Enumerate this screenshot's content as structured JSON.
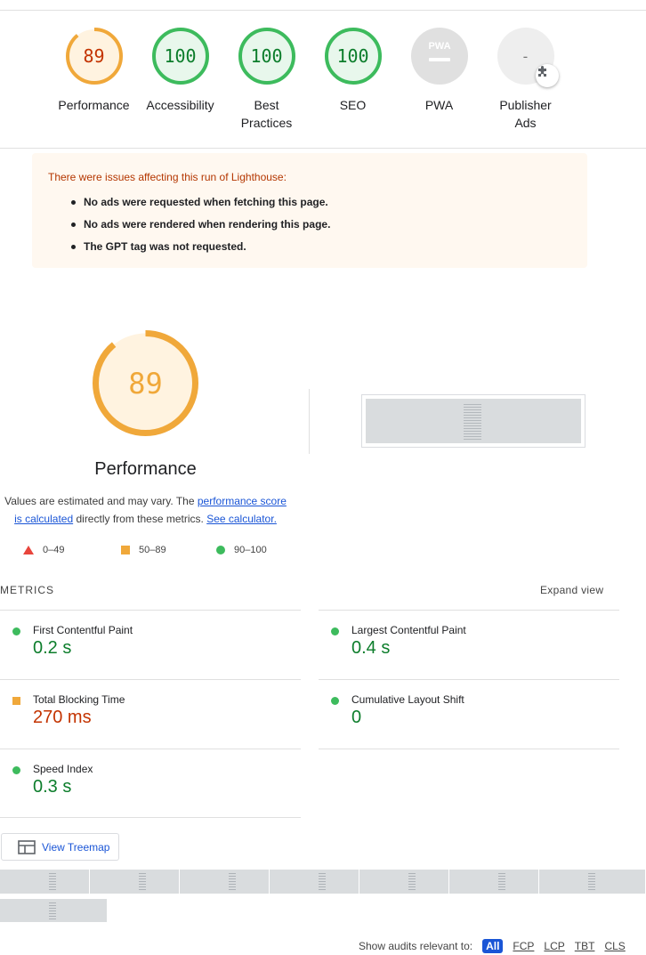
{
  "gauges": [
    {
      "value": "89",
      "score": 0.89,
      "label": "Performance",
      "status": "average"
    },
    {
      "value": "100",
      "score": 1.0,
      "label": "Accessibility",
      "status": "pass"
    },
    {
      "value": "100",
      "score": 1.0,
      "label": "Best Practices",
      "label_line1": "Best",
      "label_line2": "Practices",
      "status": "pass"
    },
    {
      "value": "100",
      "score": 1.0,
      "label": "SEO",
      "status": "pass"
    },
    {
      "value": "PWA",
      "label": "PWA",
      "status": "na",
      "icon": "pwa-icon"
    },
    {
      "value": "-",
      "label": "Publisher Ads",
      "label_line1": "Publisher",
      "label_line2": "Ads",
      "status": "na",
      "icon": "puzzle-plugin-icon"
    }
  ],
  "warning": {
    "title": "There were issues affecting this run of Lighthouse:",
    "items": [
      "No ads were requested when fetching this page.",
      "No ads were rendered when rendering this page.",
      "The GPT tag was not requested."
    ]
  },
  "performance": {
    "score": "89",
    "score_fraction": 0.89,
    "title": "Performance",
    "note_prefix": "Values are estimated and may vary. The ",
    "note_link1": "performance score is calculated",
    "note_middle": " directly from these metrics. ",
    "note_link2": "See calculator."
  },
  "legend": [
    {
      "range": "0–49",
      "shape": "triangle",
      "color": "#e8453c"
    },
    {
      "range": "50–89",
      "shape": "square",
      "color": "#f0a83a"
    },
    {
      "range": "90–100",
      "shape": "circle",
      "color": "#3dbb5d"
    }
  ],
  "metrics": {
    "heading": "METRICS",
    "expand_label": "Expand view",
    "items": [
      {
        "name": "First Contentful Paint",
        "value": "0.2 s",
        "status": "pass"
      },
      {
        "name": "Largest Contentful Paint",
        "value": "0.4 s",
        "status": "pass"
      },
      {
        "name": "Total Blocking Time",
        "value": "270 ms",
        "status": "average"
      },
      {
        "name": "Cumulative Layout Shift",
        "value": "0",
        "status": "pass"
      },
      {
        "name": "Speed Index",
        "value": "0.3 s",
        "status": "pass"
      }
    ]
  },
  "treemap": {
    "label": "View Treemap",
    "icon": "treemap-icon"
  },
  "filmstrip": {
    "frame_count": 8
  },
  "filter": {
    "label": "Show audits relevant to:",
    "chips": [
      "All",
      "FCP",
      "LCP",
      "TBT",
      "CLS"
    ],
    "active": "All"
  },
  "colors": {
    "pass": "#0c7d2b",
    "average": "#c33300",
    "average_ring": "#f0a83a",
    "pass_ring": "#3dbb5d",
    "link": "#1a55d6",
    "warning_bg": "#fff8f0"
  }
}
